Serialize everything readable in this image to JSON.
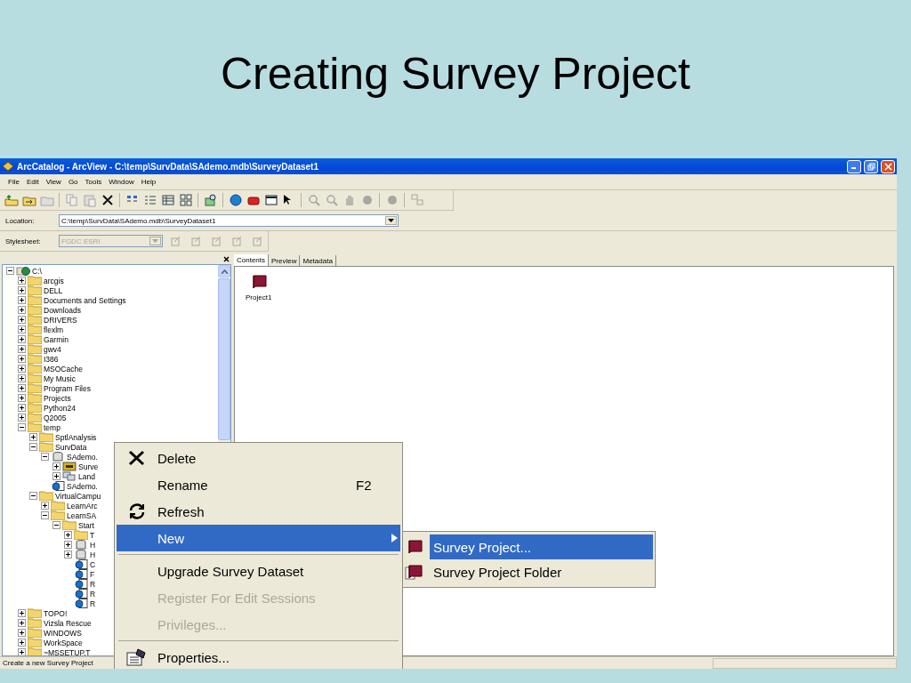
{
  "slide": {
    "title": "Creating Survey Project"
  },
  "window": {
    "title": "ArcCatalog - ArcView - C:\\temp\\SurvData\\SAdemo.mdb\\SurveyDataset1"
  },
  "menu_bar": [
    "File",
    "Edit",
    "View",
    "Go",
    "Tools",
    "Window",
    "Help"
  ],
  "location": {
    "label": "Location:",
    "value": "C:\\temp\\SurvData\\SAdemo.mdb\\SurveyDataset1"
  },
  "stylesheet": {
    "label": "Stylesheet:",
    "value": "FGDC ESRI",
    "disabled": true
  },
  "tree": [
    {
      "label": "C:\\",
      "kind": "drive",
      "expanded": true,
      "children": [
        {
          "label": "arcgis",
          "kind": "folder",
          "expanded": false
        },
        {
          "label": "DELL",
          "kind": "folder",
          "expanded": false
        },
        {
          "label": "Documents and Settings",
          "kind": "folder",
          "expanded": false
        },
        {
          "label": "Downloads",
          "kind": "folder",
          "expanded": false
        },
        {
          "label": "DRIVERS",
          "kind": "folder",
          "expanded": false
        },
        {
          "label": "flexlm",
          "kind": "folder",
          "expanded": false
        },
        {
          "label": "Garmin",
          "kind": "folder",
          "expanded": false
        },
        {
          "label": "gwv4",
          "kind": "folder",
          "expanded": false
        },
        {
          "label": "I386",
          "kind": "folder",
          "expanded": false
        },
        {
          "label": "MSOCache",
          "kind": "folder",
          "expanded": false
        },
        {
          "label": "My Music",
          "kind": "folder",
          "expanded": false
        },
        {
          "label": "Program Files",
          "kind": "folder",
          "expanded": false
        },
        {
          "label": "Projects",
          "kind": "folder",
          "expanded": false
        },
        {
          "label": "Python24",
          "kind": "folder",
          "expanded": false
        },
        {
          "label": "Q2005",
          "kind": "folder",
          "expanded": false
        },
        {
          "label": "temp",
          "kind": "folder",
          "expanded": true,
          "children": [
            {
              "label": "SptlAnalysis",
              "kind": "folder",
              "expanded": false
            },
            {
              "label": "SurvData",
              "kind": "folder",
              "expanded": true,
              "children": [
                {
                  "label": "SAdemo.",
                  "kind": "database",
                  "expanded": true,
                  "children": [
                    {
                      "label": "Surve",
                      "kind": "survey",
                      "expanded": false
                    },
                    {
                      "label": "Land",
                      "kind": "dataset",
                      "expanded": false
                    }
                  ]
                },
                {
                  "label": "SAdemo.",
                  "kind": "layer"
                }
              ]
            },
            {
              "label": "VirtualCampu",
              "kind": "folder",
              "expanded": true,
              "children": [
                {
                  "label": "LearnArc",
                  "kind": "folder",
                  "expanded": false
                },
                {
                  "label": "LearnSA",
                  "kind": "folder",
                  "expanded": true,
                  "children": [
                    {
                      "label": "Start",
                      "kind": "folder",
                      "expanded": true,
                      "children": [
                        {
                          "label": "T",
                          "kind": "folder",
                          "expanded": false
                        },
                        {
                          "label": "H",
                          "kind": "database",
                          "expanded": false
                        },
                        {
                          "label": "H",
                          "kind": "database",
                          "expanded": false
                        },
                        {
                          "label": "C",
                          "kind": "layer"
                        },
                        {
                          "label": "F",
                          "kind": "layer"
                        },
                        {
                          "label": "R",
                          "kind": "layer"
                        },
                        {
                          "label": "R",
                          "kind": "layer"
                        },
                        {
                          "label": "R",
                          "kind": "layer"
                        }
                      ]
                    }
                  ]
                }
              ]
            }
          ]
        },
        {
          "label": "TOPO!",
          "kind": "folder",
          "expanded": false
        },
        {
          "label": "Vizsla Rescue",
          "kind": "folder",
          "expanded": false
        },
        {
          "label": "WINDOWS",
          "kind": "folder",
          "expanded": false
        },
        {
          "label": "WorkSpace",
          "kind": "folder",
          "expanded": false
        },
        {
          "label": "~MSSETUP.T",
          "kind": "folder",
          "expanded": false
        }
      ]
    }
  ],
  "tabs": [
    {
      "label": "Contents",
      "selected": true
    },
    {
      "label": "Preview",
      "selected": false
    },
    {
      "label": "Metadata",
      "selected": false
    }
  ],
  "contents": [
    {
      "name": "Project1"
    }
  ],
  "context_menu": [
    {
      "kind": "item",
      "label": "Delete",
      "disabled": false,
      "selected": false
    },
    {
      "kind": "item",
      "label": "Rename",
      "shortcut": "F2",
      "disabled": false,
      "selected": false
    },
    {
      "kind": "item",
      "label": "Refresh",
      "disabled": false,
      "selected": false
    },
    {
      "kind": "submenu",
      "label": "New",
      "disabled": false,
      "selected": true
    },
    {
      "kind": "separator"
    },
    {
      "kind": "item",
      "label": "Upgrade Survey Dataset",
      "disabled": false,
      "selected": false
    },
    {
      "kind": "item",
      "label": "Register For Edit Sessions",
      "disabled": true,
      "selected": false
    },
    {
      "kind": "item",
      "label": "Privileges...",
      "disabled": true,
      "selected": false
    },
    {
      "kind": "separator"
    },
    {
      "kind": "item",
      "label": "Properties...",
      "disabled": false,
      "selected": false
    }
  ],
  "submenu": [
    {
      "label": "Survey Project...",
      "selected": true
    },
    {
      "label": "Survey Project Folder",
      "selected": false
    }
  ],
  "status_bar": {
    "text": "Create a new Survey Project"
  }
}
